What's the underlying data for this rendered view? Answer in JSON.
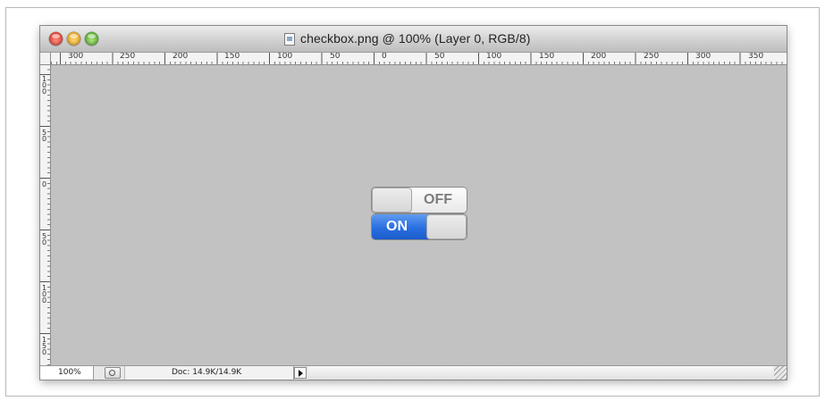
{
  "window": {
    "title": "checkbox.png @ 100% (Layer 0, RGB/8)"
  },
  "rulers": {
    "top_labels": [
      "300",
      "250",
      "200",
      "150",
      "100",
      "50",
      "0",
      "50",
      "100",
      "150",
      "200",
      "250",
      "300",
      "350"
    ],
    "left_labels": [
      "100",
      "50",
      "0",
      "50",
      "100",
      "150"
    ]
  },
  "canvas": {
    "toggle_off": {
      "label": "OFF",
      "state": "off"
    },
    "toggle_on": {
      "label": "ON",
      "state": "on",
      "accent": "#2a6fe0"
    }
  },
  "statusbar": {
    "zoom": "100%",
    "doc": "Doc: 14.9K/14.9K"
  }
}
